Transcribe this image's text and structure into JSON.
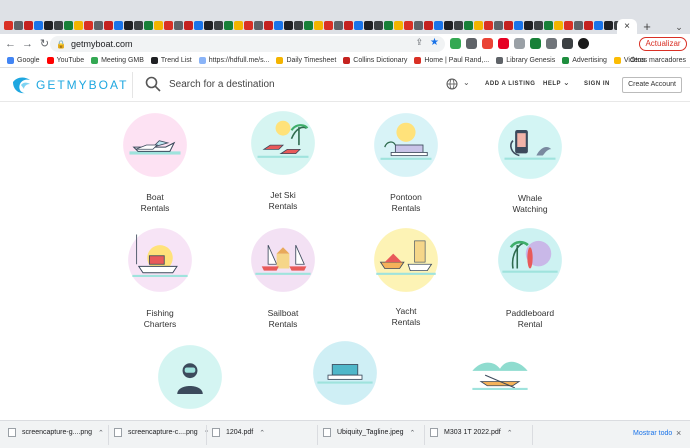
{
  "browser": {
    "active_tab_close": "×",
    "new_tab": "+",
    "tab_menu": "⌄",
    "url": "getmyboat.com",
    "update_button": "Actualizar",
    "bookmarks": [
      {
        "label": "Google",
        "color": "#4285f4"
      },
      {
        "label": "YouTube",
        "color": "#ff0000"
      },
      {
        "label": "Meeting GMB",
        "color": "#34a853"
      },
      {
        "label": "Trend List",
        "color": "#202124"
      },
      {
        "label": "https://hdfull.me/s...",
        "color": "#8ab4f8"
      },
      {
        "label": "Daily Timesheet",
        "color": "#f4b400"
      },
      {
        "label": "Collins Dictionary",
        "color": "#c5221f"
      },
      {
        "label": "Home | Paul Rand,...",
        "color": "#d93025"
      },
      {
        "label": "Library Genesis",
        "color": "#5f6368"
      },
      {
        "label": "Advertising",
        "color": "#1e8e3e"
      },
      {
        "label": "Videos",
        "color": "#fbbc04"
      }
    ],
    "other_bookmarks": "Otros marcadores"
  },
  "site": {
    "logo_text": "GETMYBOAT",
    "search_placeholder": "Search for a destination",
    "nav": {
      "add_listing": "ADD A LISTING",
      "help": "HELP",
      "sign_in": "SIGN IN",
      "create_account": "Create Account"
    },
    "categories": [
      {
        "label": "Boat\nRentals",
        "icon": "speedboat-icon",
        "bg": "#fde2f3"
      },
      {
        "label": "Jet Ski\nRentals",
        "icon": "jetski-icon",
        "bg": "#d6f5f2"
      },
      {
        "label": "Pontoon\nRentals",
        "icon": "pontoon-icon",
        "bg": "#d8f3f7"
      },
      {
        "label": "Whale\nWatching",
        "icon": "whale-icon",
        "bg": "#d3f5f4"
      },
      {
        "label": "Fishing\nCharters",
        "icon": "fishing-boat-icon",
        "bg": "#f7e4f6"
      },
      {
        "label": "Sailboat\nRentals",
        "icon": "sailboat-icon",
        "bg": "#f3e1f4"
      },
      {
        "label": "Yacht\nRentals",
        "icon": "yacht-icon",
        "bg": "#fdf3b5"
      },
      {
        "label": "Paddleboard\nRental",
        "icon": "paddleboard-icon",
        "bg": "#cdf2f2"
      },
      {
        "label": "",
        "icon": "diver-icon",
        "bg": "#d4f5f2"
      },
      {
        "label": "",
        "icon": "houseboat-icon",
        "bg": "#cfeff5"
      },
      {
        "label": "Kayak",
        "icon": "kayak-icon",
        "bg": "#ffffff"
      }
    ]
  },
  "downloads": [
    {
      "name": "screencapture-g....png"
    },
    {
      "name": "screencapture-c....png"
    },
    {
      "name": "1204.pdf"
    },
    {
      "name": "Ubiquity_Tagline.jpeg"
    },
    {
      "name": "M303 1T 2022.pdf"
    }
  ],
  "show_all": "Mostrar todo",
  "colors": {
    "brand": "#1ea7e0",
    "update": "#d93025",
    "link": "#1a73e8"
  }
}
